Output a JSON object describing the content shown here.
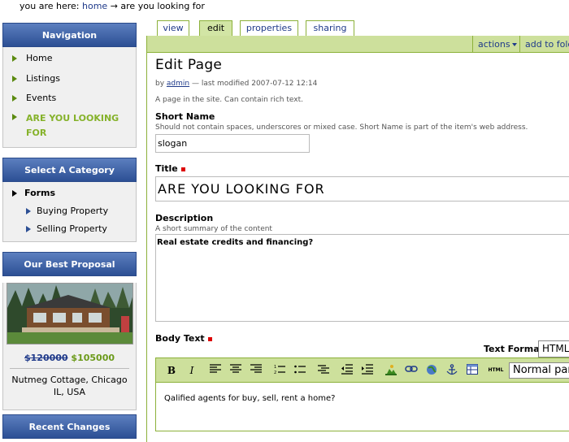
{
  "breadcrumb": {
    "prefix": "you are here:",
    "home": "home",
    "arrow": "→",
    "current": "are you looking for"
  },
  "sidebar": {
    "navigation": {
      "title": "Navigation",
      "items": [
        {
          "label": "Home"
        },
        {
          "label": "Listings"
        },
        {
          "label": "Events"
        },
        {
          "label": "ARE YOU LOOKING FOR"
        }
      ]
    },
    "category": {
      "title": "Select A Category",
      "parent": "Forms",
      "children": [
        "Buying Property",
        "Selling Property"
      ]
    },
    "proposal": {
      "title": "Our Best Proposal",
      "old_price": "$120000",
      "new_price": "$105000",
      "name": "Nutmeg Cottage, Chicago IL, USA"
    },
    "recent": {
      "title": "Recent Changes"
    }
  },
  "tabs": [
    "view",
    "edit",
    "properties",
    "sharing"
  ],
  "actionbar": {
    "actions": "actions",
    "add_folder": "add to folder"
  },
  "page": {
    "title": "Edit Page",
    "byline_by": "by",
    "author": "admin",
    "modified": "— last modified 2007-07-12 12:14",
    "description": "A page in the site. Can contain rich text."
  },
  "fields": {
    "short_name": {
      "label": "Short Name",
      "help": "Should not contain spaces, underscores or mixed case. Short Name is part of the item's web address.",
      "value": "slogan"
    },
    "title": {
      "label": "Title",
      "value": "ARE YOU LOOKING FOR"
    },
    "description": {
      "label": "Description",
      "help": "A short summary of the content",
      "value": "Real estate credits and financing?"
    },
    "body": {
      "label": "Body Text",
      "format_label": "Text Format",
      "format_value": "HTML",
      "paragraph_style": "Normal paragraph",
      "html_button": "HTML",
      "content": "Qalified agents for buy, sell, rent a home?"
    }
  },
  "colors": {
    "nav_header": "#2c4f94",
    "accent_green": "#85b22a",
    "toolbar": "#cde09c",
    "required": "#dd0000"
  },
  "icons": [
    "bold-icon",
    "italic-icon",
    "align-left-icon",
    "align-center-icon",
    "align-right-icon",
    "ordered-list-icon",
    "unordered-list-icon",
    "definition-list-icon",
    "outdent-icon",
    "indent-icon",
    "insert-image-icon",
    "insert-link-icon",
    "external-link-icon",
    "anchor-icon",
    "table-icon"
  ]
}
